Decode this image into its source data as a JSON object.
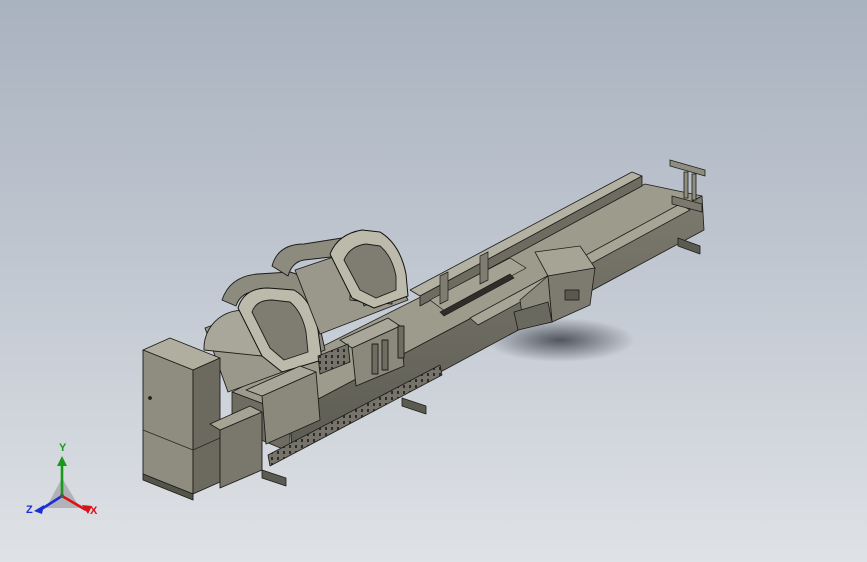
{
  "triad": {
    "x_label": "X",
    "y_label": "Y",
    "z_label": "Z",
    "x_color": "#d8141a",
    "y_color": "#1a9a1a",
    "z_color": "#1b2fd6"
  },
  "colors": {
    "background_top": "#a9b2bf",
    "background_bottom": "#dfe2e6",
    "model_body": "#8f8d7f",
    "model_shadow": "#4c4b43",
    "edge": "#1c1c1a"
  }
}
